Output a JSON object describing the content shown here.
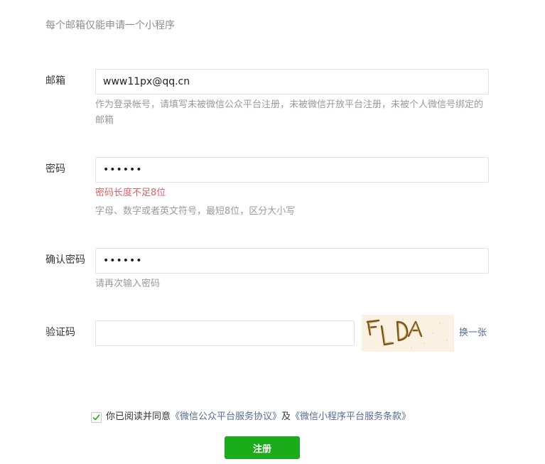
{
  "intro_text": "每个邮箱仅能申请一个小程序",
  "email": {
    "label": "邮箱",
    "value": "www11px@qq.cn",
    "tip": "作为登录帐号，请填写未被微信公众平台注册，未被微信开放平台注册，未被个人微信号绑定的邮箱"
  },
  "password": {
    "label": "密码",
    "masked_value": "••••••",
    "error": "密码长度不足8位",
    "tip": "字母、数字或者英文符号，最短8位，区分大小写"
  },
  "confirm_password": {
    "label": "确认密码",
    "masked_value": "••••••",
    "tip": "请再次输入密码"
  },
  "captcha": {
    "label": "验证码",
    "value": "",
    "image_text": "FLDA",
    "swap_label": "换一张"
  },
  "agreement": {
    "prefix": "你已阅读并同意",
    "link1": "《微信公众平台服务协议》",
    "middle": "及",
    "link2": "《微信小程序平台服务条款》",
    "checked": true
  },
  "submit_label": "注册",
  "colors": {
    "accent_green": "#1aad19",
    "link_blue": "#576b95",
    "error_red": "#e15f63"
  }
}
